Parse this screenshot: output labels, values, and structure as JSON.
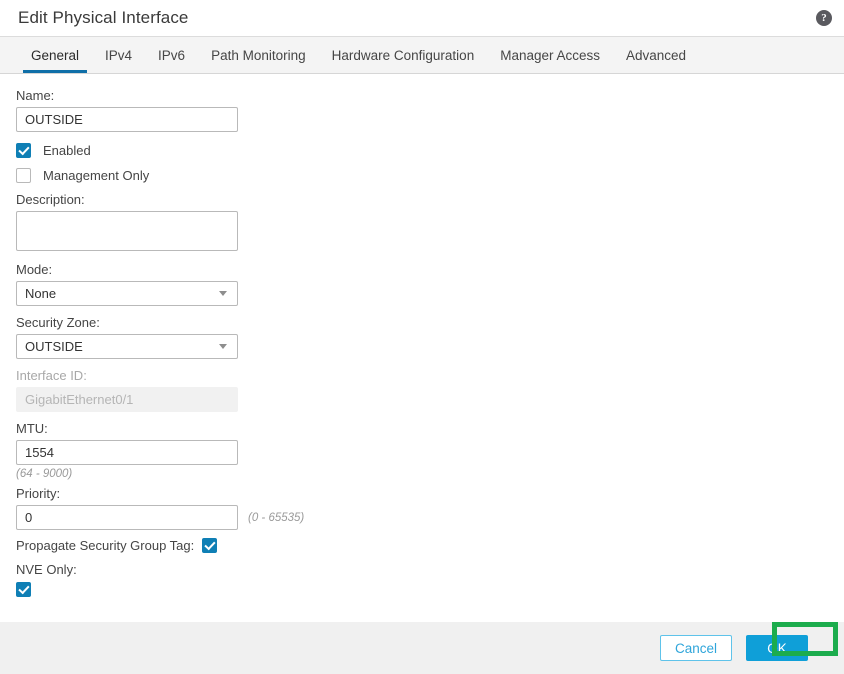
{
  "header": {
    "title": "Edit Physical Interface",
    "help_icon": "help-circle-icon",
    "help_glyph": "?"
  },
  "tabs": [
    {
      "label": "General",
      "active": true
    },
    {
      "label": "IPv4",
      "active": false
    },
    {
      "label": "IPv6",
      "active": false
    },
    {
      "label": "Path Monitoring",
      "active": false
    },
    {
      "label": "Hardware Configuration",
      "active": false
    },
    {
      "label": "Manager Access",
      "active": false
    },
    {
      "label": "Advanced",
      "active": false
    }
  ],
  "form": {
    "name": {
      "label": "Name:",
      "value": "OUTSIDE"
    },
    "enabled": {
      "label": "Enabled",
      "checked": true
    },
    "management_only": {
      "label": "Management Only",
      "checked": false
    },
    "description": {
      "label": "Description:",
      "value": ""
    },
    "mode": {
      "label": "Mode:",
      "value": "None"
    },
    "security_zone": {
      "label": "Security Zone:",
      "value": "OUTSIDE"
    },
    "interface_id": {
      "label": "Interface ID:",
      "value": "GigabitEthernet0/1",
      "disabled": true
    },
    "mtu": {
      "label": "MTU:",
      "value": "1554",
      "hint": "(64 - 9000)"
    },
    "priority": {
      "label": "Priority:",
      "value": "0",
      "hint": "(0 - 65535)"
    },
    "propagate_sgt": {
      "label": "Propagate Security Group Tag:",
      "checked": true
    },
    "nve_only": {
      "label": "NVE Only:",
      "checked": true
    }
  },
  "footer": {
    "cancel_label": "Cancel",
    "ok_label": "OK"
  },
  "annotations": {
    "color": "#1cac4d",
    "targets": [
      "nve-only-field",
      "ok-button"
    ]
  },
  "colors": {
    "accent_blue": "#0f7fb5",
    "tab_underline": "#0f6fa8",
    "ok_button": "#0f9fd8",
    "cancel_border": "#5fc3ea",
    "highlight_green": "#1cac4d"
  }
}
